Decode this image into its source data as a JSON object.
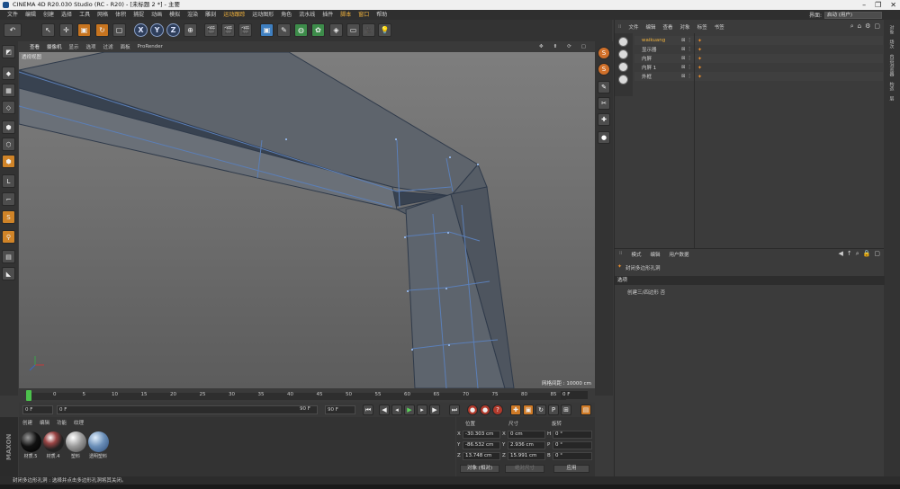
{
  "title_bar": {
    "text": "CINEMA 4D R20.030 Studio (RC - R20) - [未标题 2 *] - 主要",
    "controls": [
      "–",
      "❐",
      "✕"
    ]
  },
  "menu": [
    "文件",
    "编辑",
    "创建",
    "选择",
    "工具",
    "网格",
    "体积",
    "捕捉",
    "动画",
    "模拟",
    "渲染",
    "雕刻",
    "运动跟踪",
    "运动图形",
    "角色",
    "流水线",
    "插件",
    "脚本",
    "窗口",
    "帮助"
  ],
  "menu_highlight": [
    "运动跟踪",
    "脚本",
    "窗口"
  ],
  "layout": {
    "label": "界面:",
    "value": "启动 (用户)"
  },
  "viewport": {
    "tabs": [
      "查看",
      "摄像机",
      "显示",
      "选项",
      "过滤",
      "面板",
      "ProRender"
    ],
    "label": "透视视图",
    "grid_label": "网格间距 : 10000 cm"
  },
  "timeline": {
    "ticks": [
      "0",
      "5",
      "10",
      "15",
      "20",
      "25",
      "30",
      "35",
      "40",
      "45",
      "50",
      "55",
      "60",
      "65",
      "70",
      "75",
      "80",
      "85",
      "90"
    ],
    "frame_field": "0 F"
  },
  "transport": {
    "start": "0 F",
    "slider_start": "0 F",
    "end": "90 F",
    "end2": "90 F"
  },
  "materials": {
    "tabs": [
      "创建",
      "编辑",
      "功能",
      "纹理"
    ],
    "items": [
      {
        "label": "材质.5",
        "color": "#111111"
      },
      {
        "label": "材质.4",
        "color": "#5a5a5a"
      },
      {
        "label": "塑料",
        "color": "#9a9a9a"
      },
      {
        "label": "透明塑料",
        "color": "#6b8fb8"
      }
    ]
  },
  "maxon_brand": "MAXON CINEMA4D",
  "coords": {
    "headers": [
      "位置",
      "尺寸",
      "旋转"
    ],
    "rows": [
      {
        "axis": "X",
        "pos": "-30.303 cm",
        "size_axis": "X",
        "size": "0 cm",
        "rot_axis": "H",
        "rot": "0 °"
      },
      {
        "axis": "Y",
        "pos": "-86.532 cm",
        "size_axis": "Y",
        "size": "2.936 cm",
        "rot_axis": "P",
        "rot": "0 °"
      },
      {
        "axis": "Z",
        "pos": "13.748 cm",
        "size_axis": "Z",
        "size": "15.991 cm",
        "rot_axis": "B",
        "rot": "0 °"
      }
    ],
    "mode": "对象 (相对)",
    "size_mode": "绝对尺寸",
    "apply": "应用"
  },
  "objects": {
    "menu": [
      "文件",
      "编辑",
      "查看",
      "对象",
      "标签",
      "书签"
    ],
    "items": [
      {
        "name": "waikuang",
        "selected": true
      },
      {
        "name": "显示器",
        "selected": false
      },
      {
        "name": "内屏",
        "selected": false
      },
      {
        "name": "内屏 1",
        "selected": false
      },
      {
        "name": "外框",
        "selected": false
      }
    ]
  },
  "attributes": {
    "menu": [
      "模式",
      "编辑",
      "用户数据"
    ],
    "title": "封闭多边形孔洞",
    "tab": "选项",
    "option": "创建三/四边形  否"
  },
  "right_vtabs": [
    "对象",
    "场次",
    "内容浏览器",
    "构造",
    "层"
  ],
  "status": "封闭多边形孔洞 : 选择并点击多边形孔洞将其关闭。"
}
